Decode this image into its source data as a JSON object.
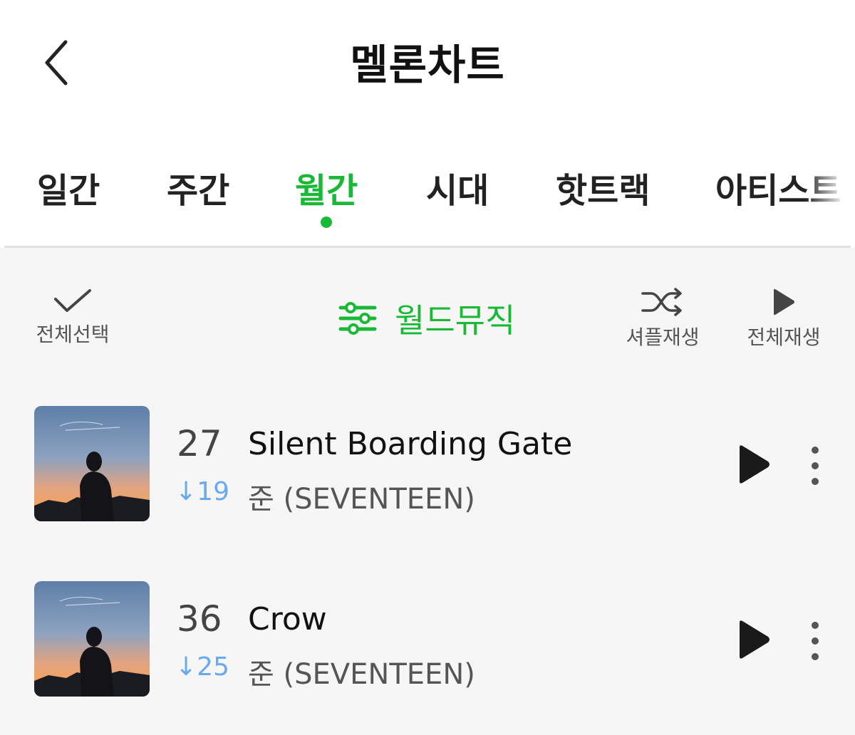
{
  "header": {
    "title": "멜론차트",
    "back_icon": "chevron-left-icon"
  },
  "tabs": [
    {
      "label": "일간",
      "active": false
    },
    {
      "label": "주간",
      "active": false
    },
    {
      "label": "월간",
      "active": true
    },
    {
      "label": "시대",
      "active": false
    },
    {
      "label": "핫트랙",
      "active": false
    },
    {
      "label": "아티스트",
      "active": false
    }
  ],
  "toolbar": {
    "select_all_label": "전체선택",
    "filter_label": "월드뮤직",
    "shuffle_label": "셔플재생",
    "play_all_label": "전체재생"
  },
  "songs": [
    {
      "rank": "27",
      "change": "↓19",
      "title": "Silent Boarding Gate",
      "artist": "준 (SEVENTEEN)"
    },
    {
      "rank": "36",
      "change": "↓25",
      "title": "Crow",
      "artist": "준 (SEVENTEEN)"
    }
  ],
  "colors": {
    "accent": "#19b936",
    "rank_down": "#69a9f2",
    "background": "#f6f6f6"
  }
}
